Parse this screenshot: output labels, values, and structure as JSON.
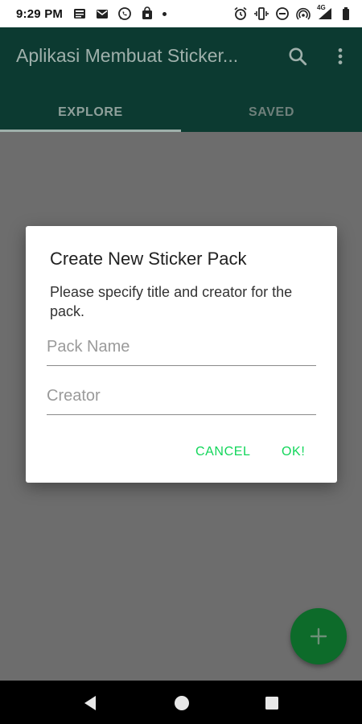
{
  "status_bar": {
    "time": "9:29 PM",
    "left_icons": [
      "news-icon",
      "gmail-icon",
      "whatsapp-icon",
      "store-icon",
      "dot-icon"
    ],
    "right_icons": [
      "alarm-icon",
      "vibrate-icon",
      "dnd-icon",
      "hotspot-icon",
      "signal-4g-icon",
      "battery-icon"
    ],
    "network_label": "4G"
  },
  "app_bar": {
    "title": "Aplikasi Membuat Sticker...",
    "color": "#0c3a31",
    "search_icon": "search-icon",
    "more_icon": "more-vert-icon"
  },
  "tabs": [
    {
      "label": "EXPLORE",
      "selected": true
    },
    {
      "label": "SAVED",
      "selected": false
    }
  ],
  "dialog": {
    "title": "Create New Sticker Pack",
    "message": "Please specify title and creator for the pack.",
    "pack_name": {
      "value": "",
      "placeholder": "Pack Name"
    },
    "creator": {
      "value": "",
      "placeholder": "Creator"
    },
    "cancel_label": "CANCEL",
    "ok_label": "OK!",
    "accent_color": "#12d65a"
  },
  "fab": {
    "icon": "plus-icon",
    "color": "#0d6b2a"
  },
  "nav_bar": {
    "icons": [
      "back-icon",
      "home-icon",
      "recents-icon"
    ]
  }
}
